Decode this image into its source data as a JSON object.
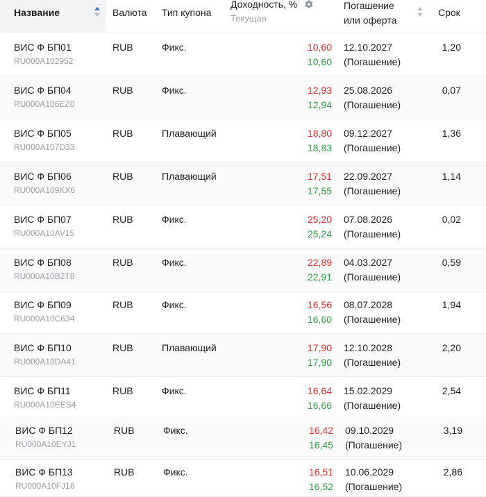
{
  "columns": {
    "name": "Название",
    "currency": "Валюта",
    "coupon_type": "Тип купона",
    "yield": "Доходность, %",
    "yield_sub": "Текущая",
    "maturity_line1": "Погашение",
    "maturity_line2": "или оферта",
    "term": "Срок"
  },
  "icons": {
    "sort": "sort-arrows-icon",
    "settings": "gear-icon"
  },
  "colors": {
    "yield_top": "#e03131",
    "yield_bottom": "#2f9e44"
  },
  "rows": [
    {
      "name": "ВИС Ф БП01",
      "isin": "RU000A102952",
      "currency": "RUB",
      "coupon": "Фикс.",
      "yield_a": "10,60",
      "yield_b": "10,60",
      "date": "12.10.2027",
      "date_note": "(Погашение)",
      "term": "1,20"
    },
    {
      "name": "ВИС Ф БП04",
      "isin": "RU000A106EZ0",
      "currency": "RUB",
      "coupon": "Фикс.",
      "yield_a": "12,93",
      "yield_b": "12,94",
      "date": "25.08.2026",
      "date_note": "(Погашение)",
      "term": "0,07"
    },
    {
      "name": "ВИС Ф БП05",
      "isin": "RU000A107D33",
      "currency": "RUB",
      "coupon": "Плавающий",
      "yield_a": "18,80",
      "yield_b": "18,83",
      "date": "09.12.2027",
      "date_note": "(Погашение)",
      "term": "1,36"
    },
    {
      "name": "ВИС Ф БП06",
      "isin": "RU000A109KX6",
      "currency": "RUB",
      "coupon": "Плавающий",
      "yield_a": "17,51",
      "yield_b": "17,55",
      "date": "22.09.2027",
      "date_note": "(Погашение)",
      "term": "1,14"
    },
    {
      "name": "ВИС Ф БП07",
      "isin": "RU000A10AV15",
      "currency": "RUB",
      "coupon": "Фикс.",
      "yield_a": "25,20",
      "yield_b": "25,24",
      "date": "07.08.2026",
      "date_note": "(Погашение)",
      "term": "0,02"
    },
    {
      "name": "ВИС Ф БП08",
      "isin": "RU000A10B2T8",
      "currency": "RUB",
      "coupon": "Фикс.",
      "yield_a": "22,89",
      "yield_b": "22,91",
      "date": "04.03.2027",
      "date_note": "(Погашение)",
      "term": "0,59"
    },
    {
      "name": "ВИС Ф БП09",
      "isin": "RU000A10C634",
      "currency": "RUB",
      "coupon": "Фикс.",
      "yield_a": "16,56",
      "yield_b": "16,60",
      "date": "08.07.2028",
      "date_note": "(Погашение)",
      "term": "1,94"
    },
    {
      "name": "ВИС Ф БП10",
      "isin": "RU000A10DA41",
      "currency": "RUB",
      "coupon": "Плавающий",
      "yield_a": "17,90",
      "yield_b": "17,90",
      "date": "12.10.2028",
      "date_note": "(Погашение)",
      "term": "2,20"
    },
    {
      "name": "ВИС Ф БП11",
      "isin": "RU000A10EES4",
      "currency": "RUB",
      "coupon": "Фикс.",
      "yield_a": "16,64",
      "yield_b": "16,66",
      "date": "15.02.2029",
      "date_note": "(Погашение)",
      "term": "2,54"
    },
    {
      "name": "ВИС Ф БП12",
      "isin": "RU000A10EYJ1",
      "currency": "RUB",
      "coupon": "Фикс.",
      "yield_a": "16,42",
      "yield_b": "16,45",
      "date": "09.10.2029",
      "date_note": "(Погашение)",
      "term": "3,19"
    },
    {
      "name": "ВИС Ф БП13",
      "isin": "RU000A10FJ16",
      "currency": "RUB",
      "coupon": "Фикс.",
      "yield_a": "16,51",
      "yield_b": "16,52",
      "date": "10.06.2029",
      "date_note": "(Погашение)",
      "term": "2,86"
    }
  ]
}
